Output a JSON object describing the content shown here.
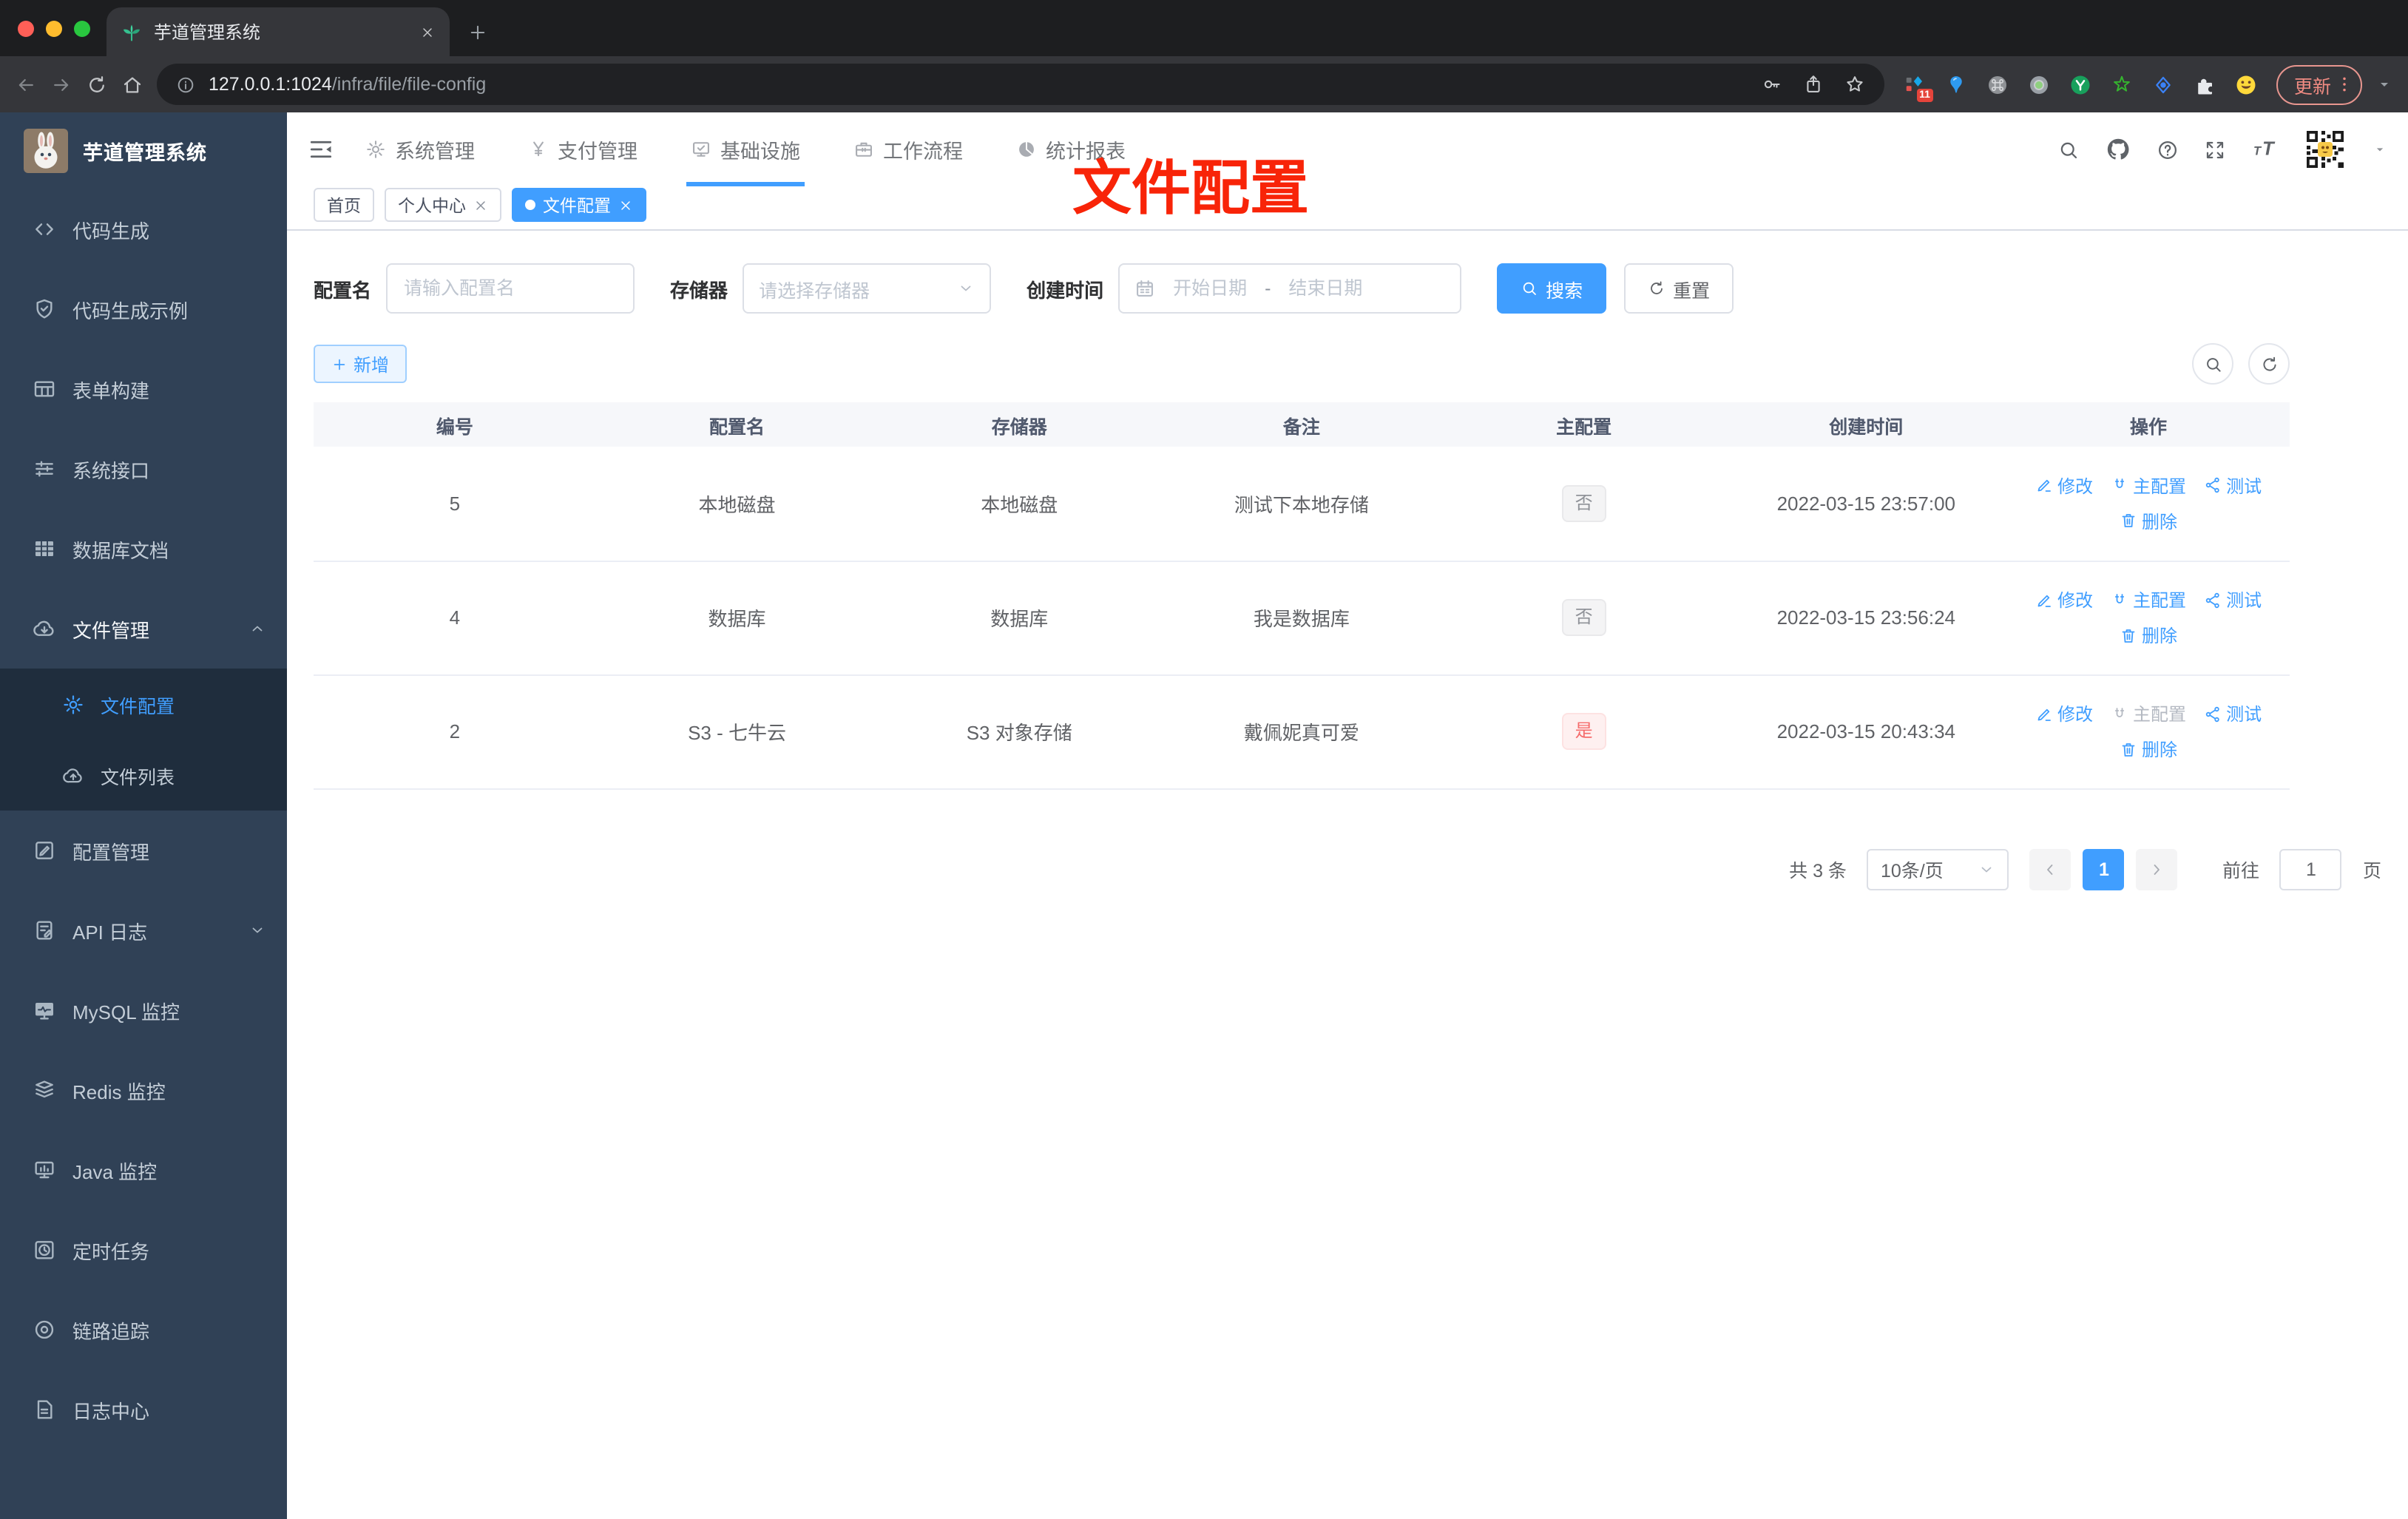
{
  "browser": {
    "tab_title": "芋道管理系统",
    "url_host": "127.0.0.1:1024",
    "url_path": "/infra/file/file-config",
    "extension_badge": "11",
    "update_label": "更新"
  },
  "sidebar": {
    "title": "芋道管理系统",
    "items": [
      {
        "key": "code-generate",
        "label": "代码生成",
        "icon": "code"
      },
      {
        "key": "code-demo",
        "label": "代码生成示例",
        "icon": "shield-check"
      },
      {
        "key": "form-builder",
        "label": "表单构建",
        "icon": "form-grid"
      },
      {
        "key": "system-api",
        "label": "系统接口",
        "icon": "sliders"
      },
      {
        "key": "db-doc",
        "label": "数据库文档",
        "icon": "db-table"
      },
      {
        "key": "file-manage",
        "label": "文件管理",
        "icon": "cloud-download",
        "expanded": true,
        "active_parent": true,
        "children": [
          {
            "key": "file-config",
            "label": "文件配置",
            "icon": "gear",
            "active": true
          },
          {
            "key": "file-list",
            "label": "文件列表",
            "icon": "cloud-upload"
          }
        ]
      },
      {
        "key": "config-manage",
        "label": "配置管理",
        "icon": "edit-square"
      },
      {
        "key": "api-log",
        "label": "API 日志",
        "icon": "doc-edit",
        "collapsible": true
      },
      {
        "key": "mysql-monitor",
        "label": "MySQL 监控",
        "icon": "monitor-pulse"
      },
      {
        "key": "redis-monitor",
        "label": "Redis 监控",
        "icon": "layers"
      },
      {
        "key": "java-monitor",
        "label": "Java 监控",
        "icon": "screen-bars"
      },
      {
        "key": "job",
        "label": "定时任务",
        "icon": "timer"
      },
      {
        "key": "trace",
        "label": "链路追踪",
        "icon": "target"
      },
      {
        "key": "log-center",
        "label": "日志中心",
        "icon": "doc-log"
      }
    ]
  },
  "topnav": {
    "items": [
      {
        "key": "system",
        "label": "系统管理",
        "icon": "gear"
      },
      {
        "key": "pay",
        "label": "支付管理",
        "icon": "yen"
      },
      {
        "key": "infra",
        "label": "基础设施",
        "icon": "monitor-check",
        "active": true
      },
      {
        "key": "workflow",
        "label": "工作流程",
        "icon": "briefcase"
      },
      {
        "key": "report",
        "label": "统计报表",
        "icon": "pie"
      }
    ]
  },
  "tags": [
    {
      "key": "home",
      "label": "首页"
    },
    {
      "key": "profile",
      "label": "个人中心",
      "closable": true
    },
    {
      "key": "file-config",
      "label": "文件配置",
      "closable": true,
      "active": true
    }
  ],
  "annotation": "文件配置",
  "filter": {
    "name_label": "配置名",
    "name_placeholder": "请输入配置名",
    "storage_label": "存储器",
    "storage_placeholder": "请选择存储器",
    "date_label": "创建时间",
    "date_start_placeholder": "开始日期",
    "date_separator": "-",
    "date_end_placeholder": "结束日期",
    "search_label": "搜索",
    "reset_label": "重置"
  },
  "toolbar": {
    "add_label": "新增"
  },
  "table": {
    "columns": [
      "编号",
      "配置名",
      "存储器",
      "备注",
      "主配置",
      "创建时间",
      "操作"
    ],
    "actions": {
      "edit": "修改",
      "master": "主配置",
      "test": "测试",
      "delete": "删除"
    },
    "rows": [
      {
        "id": "5",
        "name": "本地磁盘",
        "storage": "本地磁盘",
        "remark": "测试下本地存储",
        "master": "否",
        "master_state": "no",
        "created": "2022-03-15 23:57:00",
        "master_action_disabled": false
      },
      {
        "id": "4",
        "name": "数据库",
        "storage": "数据库",
        "remark": "我是数据库",
        "master": "否",
        "master_state": "no",
        "created": "2022-03-15 23:56:24",
        "master_action_disabled": false
      },
      {
        "id": "2",
        "name": "S3 - 七牛云",
        "storage": "S3 对象存储",
        "remark": "戴佩妮真可爱",
        "master": "是",
        "master_state": "yes",
        "created": "2022-03-15 20:43:34",
        "master_action_disabled": true
      }
    ]
  },
  "pagination": {
    "total": "共 3 条",
    "page_size": "10条/页",
    "current": "1",
    "goto_label": "前往",
    "goto_value": "1",
    "page_unit": "页"
  },
  "colors": {
    "accent": "#409eff",
    "danger": "#f56c6c",
    "info_badge": "#909399",
    "annotation": "#f82408",
    "sidebar_bg": "#304156",
    "submenu_bg": "#1f2d3d"
  }
}
